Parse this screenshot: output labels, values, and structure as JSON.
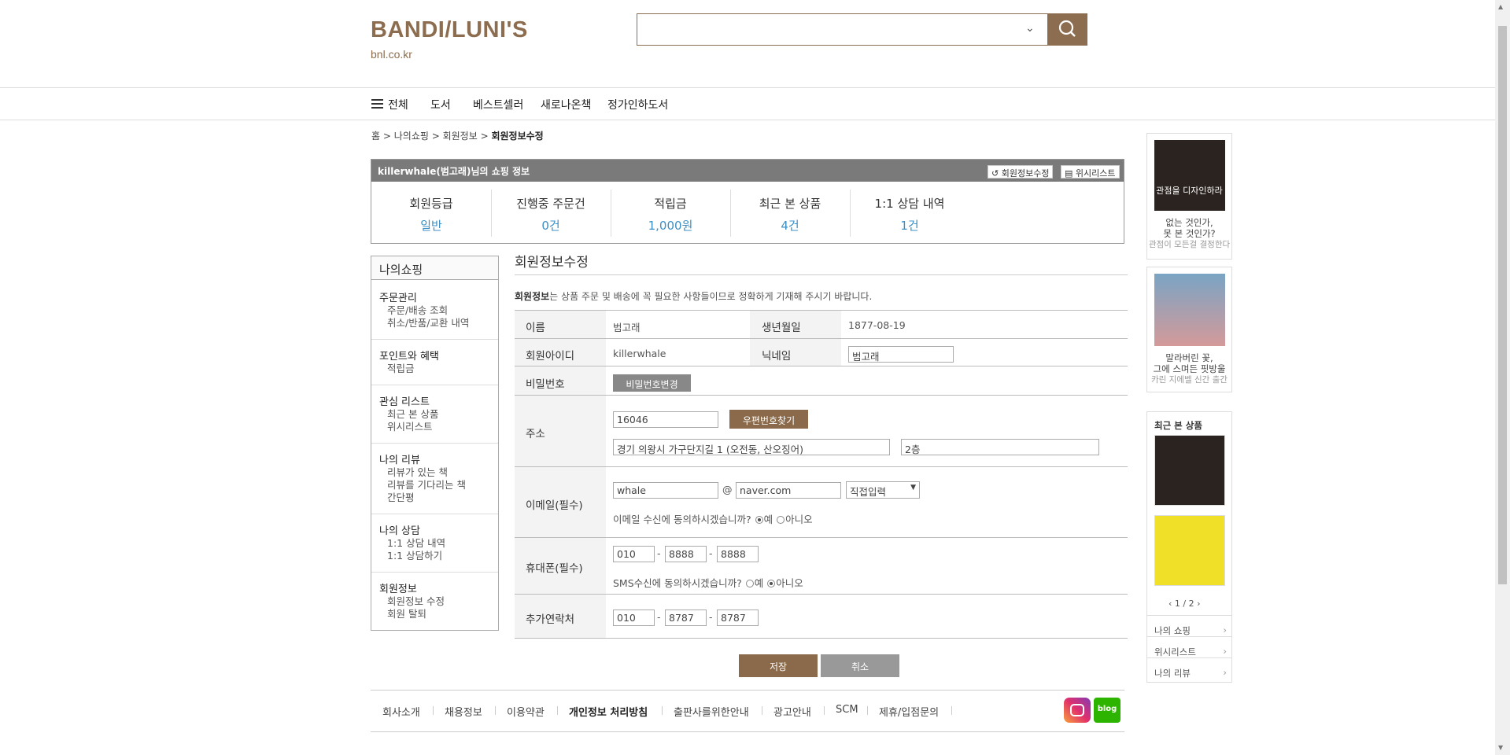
{
  "header": {
    "logo": "BANDI/LUNI'S",
    "logo_sub": "bnl.co.kr"
  },
  "nav": {
    "all": "전체",
    "items": [
      "도서",
      "베스트셀러",
      "새로나온책",
      "정가인하도서"
    ]
  },
  "breadcrumb": {
    "home": "홈",
    "s1": "나의쇼핑",
    "s2": "회원정보",
    "current": "회원정보수정"
  },
  "shop_info": {
    "title": "killerwhale(범고래)님의 쇼핑 정보",
    "edit_btn": "회원정보수정",
    "wish_btn": "위시리스트",
    "stats": [
      {
        "label": "회원등급",
        "value": "일반"
      },
      {
        "label": "진행중 주문건",
        "value": "0건"
      },
      {
        "label": "적립금",
        "value": "1,000원"
      },
      {
        "label": "최근 본 상품",
        "value": "4건"
      },
      {
        "label": "1:1 상담 내역",
        "value": "1건"
      }
    ]
  },
  "sidebar": {
    "title": "나의쇼핑",
    "groups": [
      {
        "head": "주문관리",
        "items": [
          "주문/배송 조회",
          "취소/반품/교환 내역"
        ]
      },
      {
        "head": "포인트와 혜택",
        "items": [
          "적립금"
        ]
      },
      {
        "head": "관심 리스트",
        "items": [
          "최근 본 상품",
          "위시리스트"
        ]
      },
      {
        "head": "나의 리뷰",
        "items": [
          "리뷰가 있는 책",
          "리뷰를 기다리는 책",
          "간단평"
        ]
      },
      {
        "head": "나의 상담",
        "items": [
          "1:1 상담 내역",
          "1:1 상담하기"
        ]
      },
      {
        "head": "회원정보",
        "items": [
          "회원정보 수정",
          "회원 탈퇴"
        ]
      }
    ]
  },
  "form": {
    "title": "회원정보수정",
    "note_bold": "회원정보",
    "note_rest": "는 상품 주문 및 배송에 꼭 필요한 사항들이므로 정확하게 기재해 주시기 바랍니다.",
    "name_label": "이름",
    "name": "범고래",
    "birth_label": "생년월일",
    "birth": "1877-08-19",
    "id_label": "회원아이디",
    "id": "killerwhale",
    "nick_label": "닉네임",
    "nick": "범고래",
    "pw_label": "비밀번호",
    "pw_btn": "비밀번호변경",
    "addr_label": "주소",
    "zip": "16046",
    "zip_btn": "우편번호찾기",
    "addr1": "경기 의왕시 가구단지길 1 (오전동, 산오징어)",
    "addr2": "2층",
    "email_label": "이메일(필수)",
    "email_id": "whale",
    "at": "@",
    "email_domain": "naver.com",
    "email_select": "직접입력",
    "email_agree_q": "이메일 수신에 동의하시겠습니까?",
    "yes": "예",
    "no": "아니오",
    "phone_label": "휴대폰(필수)",
    "phone1": "010",
    "phone2": "8888",
    "phone3": "8888",
    "sms_agree_q": "SMS수신에 동의하시겠습니까?",
    "extra_label": "추가연락처",
    "extra1": "010",
    "extra2": "8787",
    "extra3": "8787",
    "dash": "-",
    "save": "저장",
    "cancel": "취소"
  },
  "right": {
    "ad1_title": "관점을 디자인하라",
    "ad1_l1": "없는 것인가,",
    "ad1_l2": "못 본 것인가?",
    "ad1_l3": "관점이 모든걸 결정한다",
    "ad2_l1": "말라버린 꽃,",
    "ad2_l2": "그에 스며든 핏방울",
    "ad2_l3": "카린 지에벨 신간 출간",
    "recent_title": "최근 본 상품",
    "pager": "1 / 2",
    "links": [
      "나의 쇼핑",
      "위시리스트",
      "나의 리뷰"
    ]
  },
  "footer": {
    "items": [
      "회사소개",
      "채용정보",
      "이용약관",
      "개인정보 처리방침",
      "출판사를위한안내",
      "광고안내",
      "SCM",
      "제휴/입점문의"
    ],
    "blog": "blog"
  }
}
